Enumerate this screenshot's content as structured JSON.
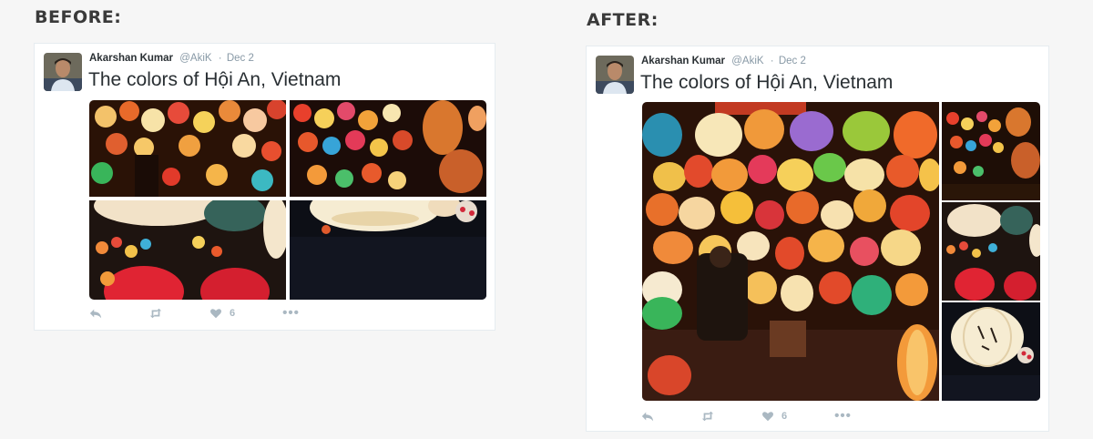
{
  "before": {
    "heading": "BEFORE:",
    "tweet": {
      "author_name": "Akarshan Kumar",
      "handle": "@AkiK",
      "separator": "·",
      "date": "Dec 2",
      "text": "The colors of Hội An, Vietnam",
      "like_count": "6"
    },
    "layout": "2x2 grid"
  },
  "after": {
    "heading": "AFTER:",
    "tweet": {
      "author_name": "Akarshan Kumar",
      "handle": "@AkiK",
      "separator": "·",
      "date": "Dec 2",
      "text": "The colors of Hội An, Vietnam",
      "like_count": "6"
    },
    "layout": "one large + three stacked"
  },
  "icons": {
    "reply": "reply-icon",
    "retweet": "retweet-icon",
    "like": "heart-icon",
    "more": "more-icon"
  },
  "colors": {
    "page_background": "#f6f6f6",
    "card_border": "#e6ecf0",
    "text_primary": "#292f33",
    "text_secondary": "#8899a6",
    "action_icon": "#aab8c2"
  }
}
